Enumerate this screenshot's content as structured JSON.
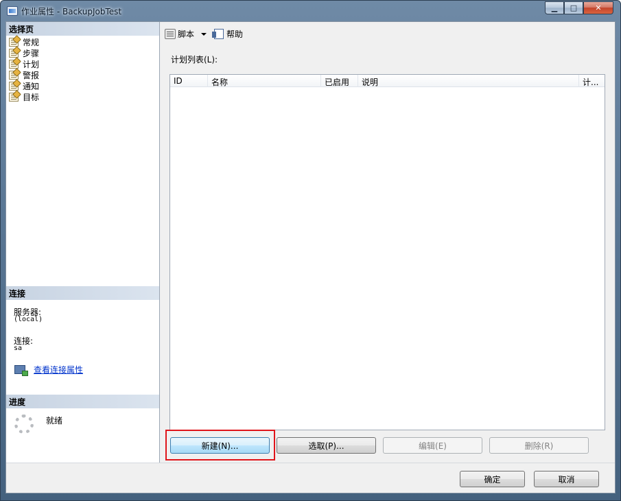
{
  "window": {
    "title": "作业属性 - BackupJobTest",
    "minimize_glyph": "▁",
    "maximize_glyph": "□",
    "close_glyph": "✕"
  },
  "left_panel": {
    "select_page_header": "选择页",
    "pages": [
      {
        "label": "常规",
        "icon": "page-properties-icon"
      },
      {
        "label": "步骤",
        "icon": "page-properties-icon"
      },
      {
        "label": "计划",
        "icon": "page-properties-icon"
      },
      {
        "label": "警报",
        "icon": "page-properties-icon"
      },
      {
        "label": "通知",
        "icon": "page-properties-icon"
      },
      {
        "label": "目标",
        "icon": "page-properties-icon"
      }
    ],
    "connection_header": "连接",
    "server_label": "服务器:",
    "server_value": "(local)",
    "connection_label": "连接:",
    "connection_value": "sa",
    "view_connection_link": "查看连接属性",
    "progress_header": "进度",
    "progress_status": "就绪"
  },
  "toolbar": {
    "script_label": "脚本",
    "help_label": "帮助"
  },
  "schedule": {
    "list_label": "计划列表(L):",
    "columns": [
      "ID",
      "名称",
      "已启用",
      "说明",
      "计..."
    ],
    "rows": []
  },
  "buttons": {
    "new": "新建(N)...",
    "pick": "选取(P)...",
    "edit": "编辑(E)",
    "delete": "删除(R)",
    "ok": "确定",
    "cancel": "取消"
  },
  "colors": {
    "highlight_border": "#e0141a",
    "link": "#0033cc",
    "section_header": "#c7d3e2"
  }
}
